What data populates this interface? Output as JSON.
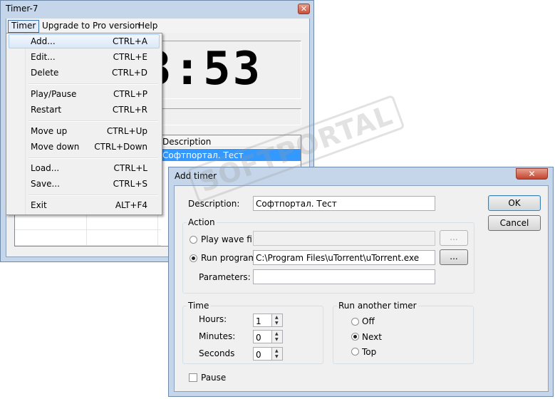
{
  "main_window": {
    "title": "Timer-7",
    "menu": [
      "Timer",
      "Upgrade to Pro version",
      "Help"
    ],
    "clock": "3:53",
    "list": {
      "column_description": "Description",
      "rows": [
        {
          "description": "Софтпортал. Тест"
        }
      ]
    }
  },
  "timer_menu": {
    "items": [
      {
        "label": "Add...",
        "shortcut": "CTRL+A"
      },
      {
        "label": "Edit...",
        "shortcut": "CTRL+E"
      },
      {
        "label": "Delete",
        "shortcut": "CTRL+D"
      },
      {
        "label": "Play/Pause",
        "shortcut": "CTRL+P"
      },
      {
        "label": "Restart",
        "shortcut": "CTRL+R"
      },
      {
        "label": "Move up",
        "shortcut": "CTRL+Up"
      },
      {
        "label": "Move down",
        "shortcut": "CTRL+Down"
      },
      {
        "label": "Load...",
        "shortcut": "CTRL+L"
      },
      {
        "label": "Save...",
        "shortcut": "CTRL+S"
      },
      {
        "label": "Exit",
        "shortcut": "ALT+F4"
      }
    ]
  },
  "add_timer_dialog": {
    "title": "Add timer",
    "close_glyph": "✕",
    "description_label": "Description:",
    "description_value": "Софтпортал. Тест",
    "ok_label": "OK",
    "cancel_label": "Cancel",
    "action": {
      "group_label": "Action",
      "play_wave_label": "Play wave file:",
      "play_wave_value": "",
      "run_program_label": "Run program:",
      "run_program_value": "C:\\Program Files\\uTorrent\\uTorrent.exe",
      "parameters_label": "Parameters:",
      "parameters_value": "",
      "browse_label": "...",
      "selected": "run_program"
    },
    "time": {
      "group_label": "Time",
      "hours_label": "Hours:",
      "hours_value": "1",
      "minutes_label": "Minutes:",
      "minutes_value": "0",
      "seconds_label": "Seconds",
      "seconds_value": "0"
    },
    "run_another": {
      "group_label": "Run another timer",
      "options": [
        "Off",
        "Next",
        "Top"
      ],
      "selected": "Next"
    },
    "pause_label": "Pause",
    "pause_checked": false
  },
  "watermark": "SOFTPORTAL"
}
